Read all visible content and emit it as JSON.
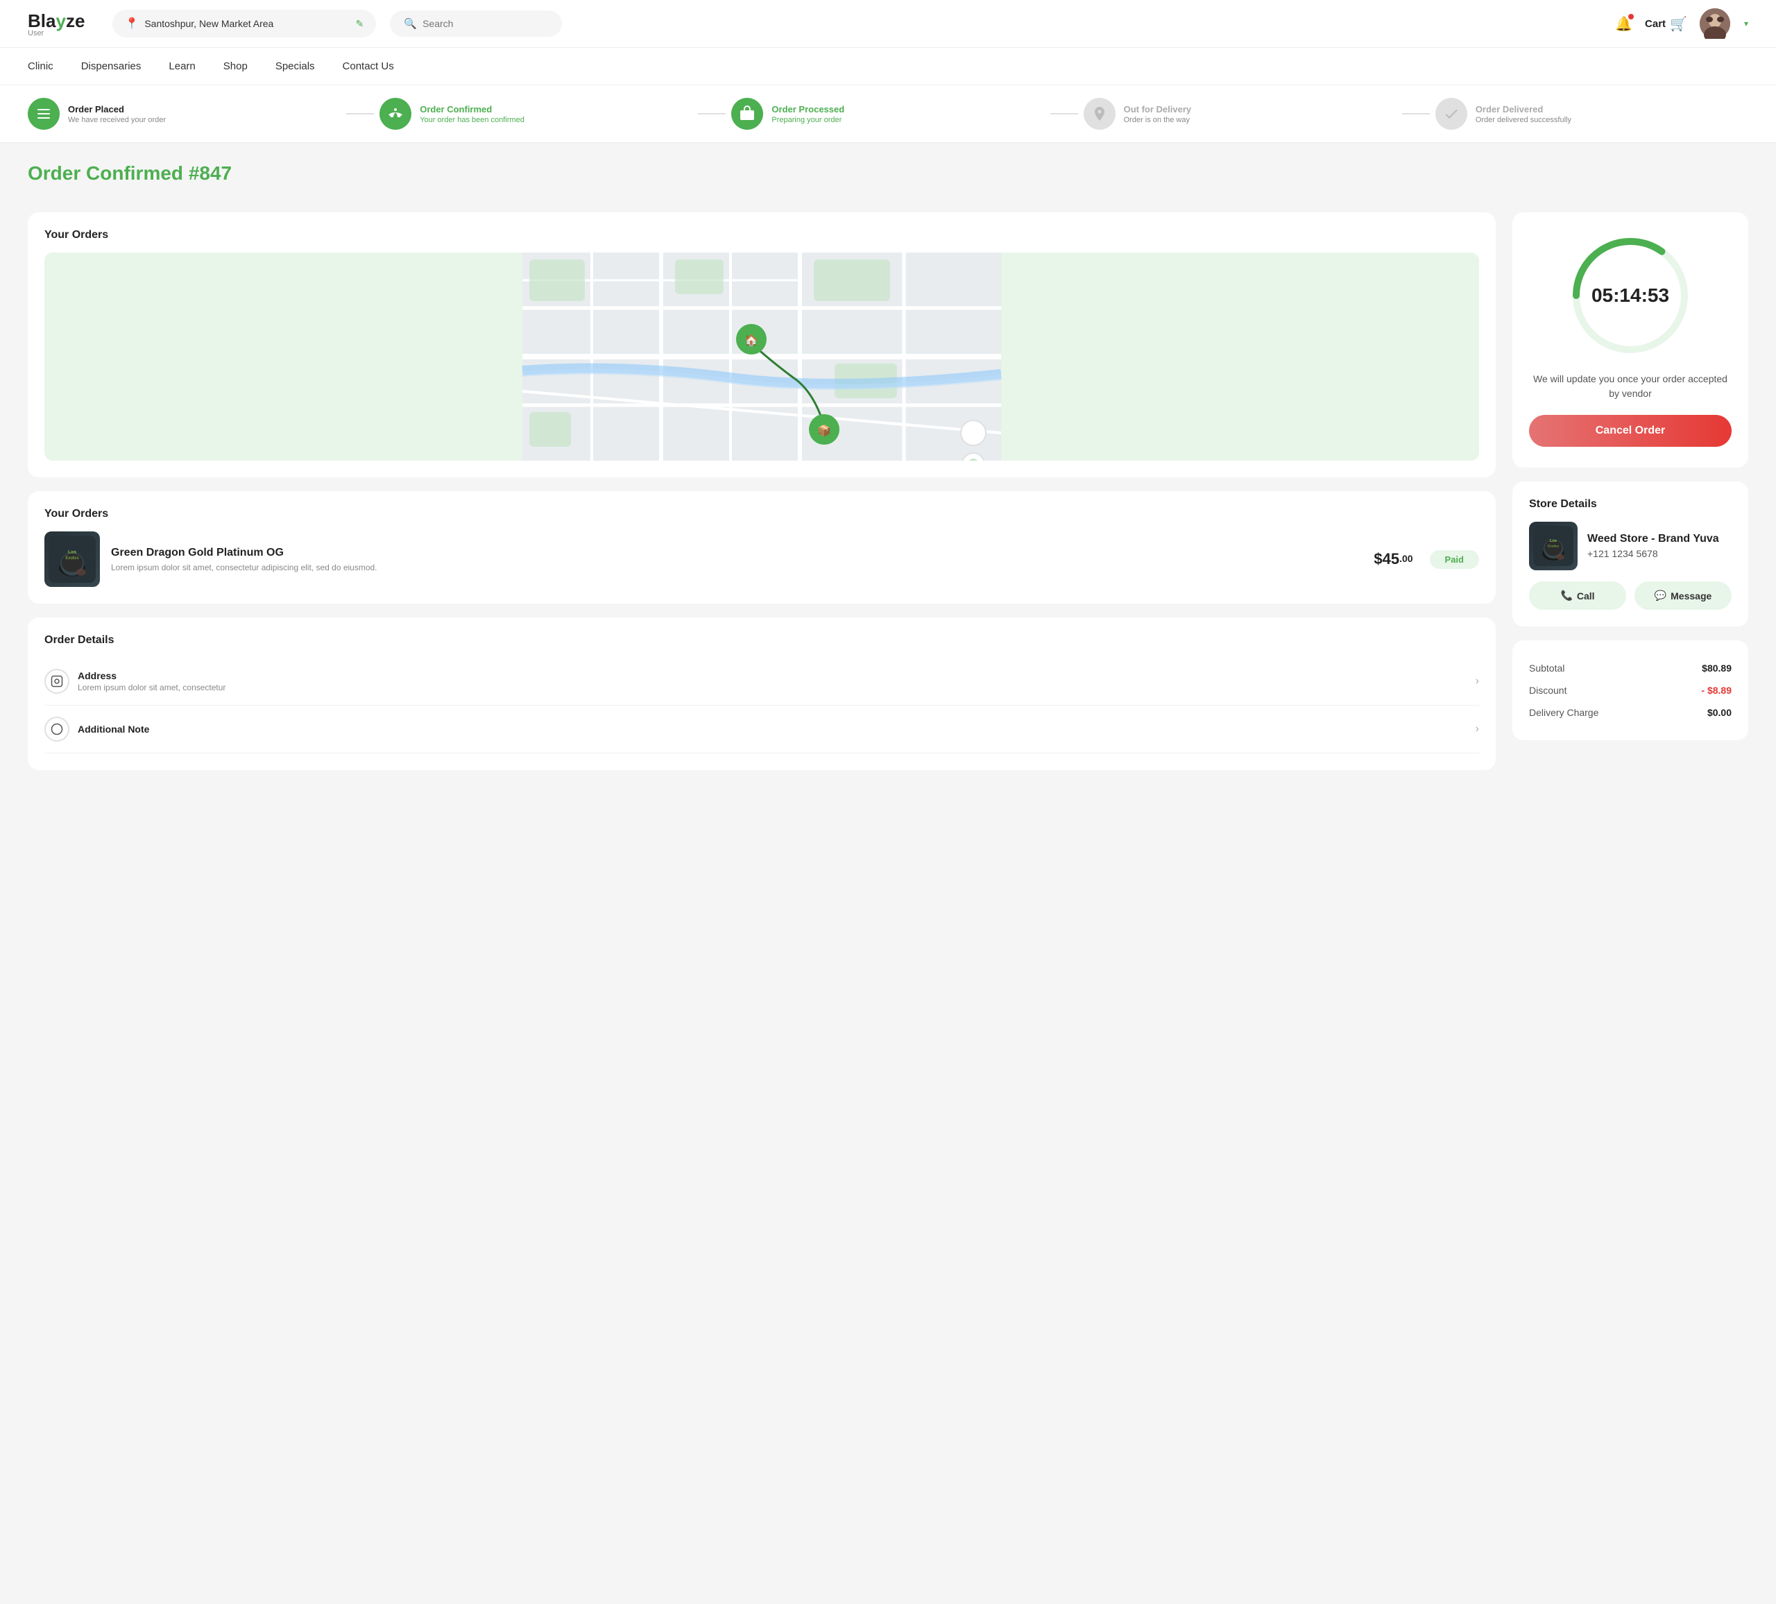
{
  "app": {
    "logo": "Blay ze",
    "logo_highlight": "y",
    "logo_sub": "User"
  },
  "header": {
    "location": "Santoshpur, New Market Area",
    "search_placeholder": "Search",
    "cart_label": "Cart",
    "user_chevron": "▾"
  },
  "nav": {
    "items": [
      {
        "label": "Clinic",
        "id": "clinic"
      },
      {
        "label": "Dispensaries",
        "id": "dispensaries"
      },
      {
        "label": "Learn",
        "id": "learn"
      },
      {
        "label": "Shop",
        "id": "shop"
      },
      {
        "label": "Specials",
        "id": "specials"
      },
      {
        "label": "Contact Us",
        "id": "contact-us"
      }
    ]
  },
  "status_steps": [
    {
      "id": "order-placed",
      "icon": "☰",
      "icon_type": "list",
      "title": "Order Placed",
      "subtitle": "We have received your order",
      "state": "done"
    },
    {
      "id": "order-confirmed",
      "icon": "👍",
      "icon_type": "thumb",
      "title": "Order Confirmed",
      "subtitle": "Your order has been confirmed",
      "state": "active"
    },
    {
      "id": "order-processed",
      "icon": "📦",
      "icon_type": "box",
      "title": "Order Processed",
      "subtitle": "Preparing your order",
      "state": "active"
    },
    {
      "id": "out-for-delivery",
      "icon": "🗺",
      "icon_type": "map",
      "title": "Out for Delivery",
      "subtitle": "Order is on the way",
      "state": "inactive"
    },
    {
      "id": "order-delivered",
      "icon": "✓",
      "icon_type": "check",
      "title": "Order Delivered",
      "subtitle": "Order delivered successfully",
      "state": "inactive"
    }
  ],
  "page": {
    "title_prefix": "Order Confirmed",
    "order_number": "#847"
  },
  "map_section": {
    "title": "Your Orders"
  },
  "timer": {
    "display": "05:14:53",
    "description": "We will update you once your order accepted by vendor",
    "cancel_label": "Cancel Order",
    "progress": 35
  },
  "order_items_section": {
    "title": "Your Orders",
    "items": [
      {
        "name": "Green Dragon Gold Platinum OG",
        "description": "Lorem ipsum dolor sit amet, consectetur adipiscing elit, sed do eiusmod.",
        "price_main": "$45",
        "price_dec": "00",
        "status": "Paid"
      }
    ]
  },
  "order_details_section": {
    "title": "Order Details",
    "rows": [
      {
        "icon": "⬡",
        "title": "Address",
        "subtitle": "Lorem ipsum dolor sit amet, consectetur"
      },
      {
        "icon": "○",
        "title": "Additional Note",
        "subtitle": ""
      }
    ]
  },
  "store_details": {
    "title": "Store Details",
    "name": "Weed Store - Brand Yuva",
    "phone": "+121  1234  5678",
    "call_label": "Call",
    "message_label": "Message"
  },
  "price_summary": {
    "subtotal_label": "Subtotal",
    "subtotal_value": "$80.89",
    "discount_label": "Discount",
    "discount_value": "- $8.89",
    "delivery_label": "Delivery Charge",
    "delivery_value": "$0.00"
  }
}
